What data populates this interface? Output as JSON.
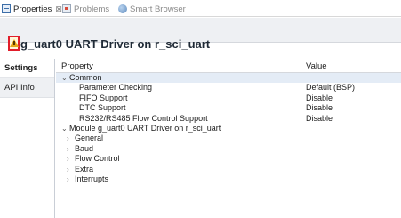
{
  "tabs": [
    {
      "label": "Properties",
      "close": "⊠",
      "icon": "properties-icon"
    },
    {
      "label": "Problems",
      "icon": "problems-icon"
    },
    {
      "label": "Smart Browser",
      "icon": "smart-browser-icon"
    }
  ],
  "title": "g_uart0 UART Driver on r_sci_uart",
  "side_tabs": [
    "Settings",
    "API Info"
  ],
  "columns": {
    "property": "Property",
    "value": "Value"
  },
  "rows": [
    {
      "label": "Common",
      "value": "",
      "chevron": "⌄",
      "indent": 0
    },
    {
      "label": "Parameter Checking",
      "value": "Default (BSP)",
      "chevron": "",
      "indent": 2
    },
    {
      "label": "FIFO Support",
      "value": "Disable",
      "chevron": "",
      "indent": 2
    },
    {
      "label": "DTC Support",
      "value": "Disable",
      "chevron": "",
      "indent": 2
    },
    {
      "label": "RS232/RS485 Flow Control Support",
      "value": "Disable",
      "chevron": "",
      "indent": 2
    },
    {
      "label": "Module g_uart0 UART Driver on r_sci_uart",
      "value": "",
      "chevron": "⌄",
      "indent": 0
    },
    {
      "label": "General",
      "value": "",
      "chevron": "›",
      "indent": 1
    },
    {
      "label": "Baud",
      "value": "",
      "chevron": "›",
      "indent": 1
    },
    {
      "label": "Flow Control",
      "value": "",
      "chevron": "›",
      "indent": 1
    },
    {
      "label": "Extra",
      "value": "",
      "chevron": "›",
      "indent": 1
    },
    {
      "label": "Interrupts",
      "value": "",
      "chevron": "›",
      "indent": 1
    }
  ],
  "colors": {
    "warning_highlight": "#e11d2a",
    "selected_row": "#e4ecf6"
  }
}
